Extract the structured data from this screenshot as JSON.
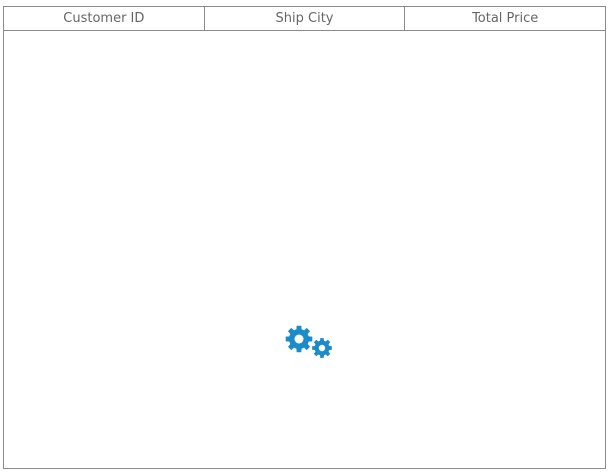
{
  "grid": {
    "columns": [
      {
        "label": "Customer ID"
      },
      {
        "label": "Ship City"
      },
      {
        "label": "Total Price"
      }
    ],
    "rows": []
  },
  "loading": {
    "icon": "gears-icon",
    "color": "#1b8bc9",
    "state": "loading"
  }
}
